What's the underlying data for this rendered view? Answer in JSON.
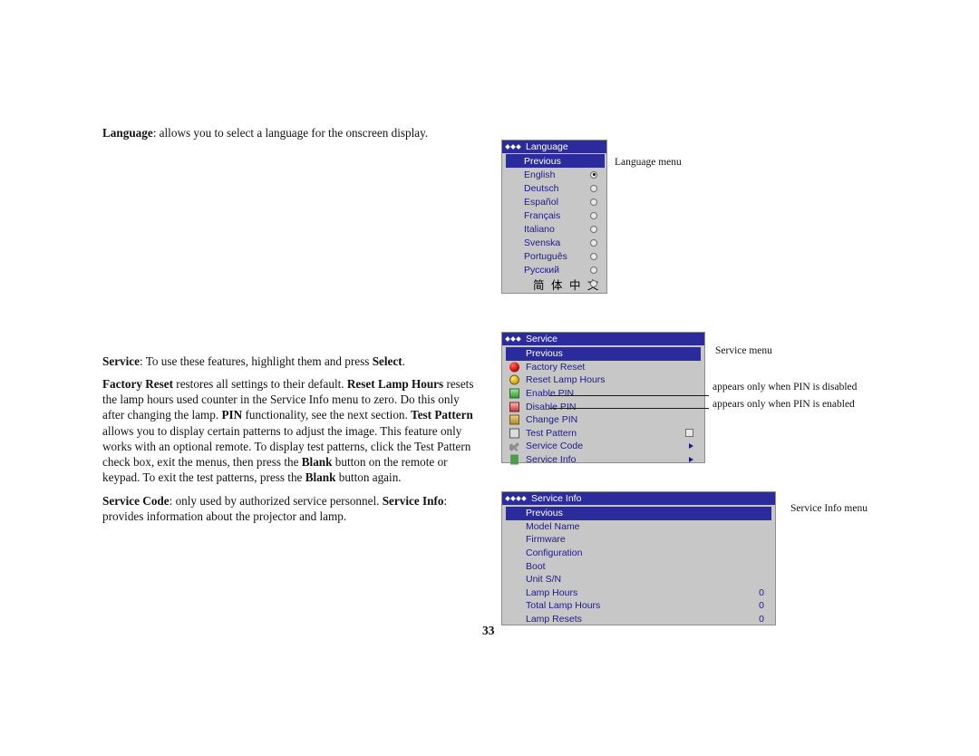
{
  "document": {
    "page_number": "33",
    "paragraphs": {
      "language": {
        "lead": "Language",
        "rest": ": allows you to select a language for the onscreen display."
      },
      "service": {
        "lead": "Service",
        "rest": ": To use these features, highlight them and press ",
        "bold_tail": "Select",
        "period": "."
      },
      "factory": {
        "b1": "Factory Reset",
        "t1": " restores all settings to their default. ",
        "b2": "Reset Lamp Hours",
        "t2": " resets the lamp hours used counter in the Service Info menu to zero. Do this only after changing the lamp. ",
        "b3": "PIN",
        "t3": " functionality, see the next section. ",
        "b4": "Test Pattern",
        "t4": " allows you to display certain patterns to adjust the image. This feature only works with an optional remote. To display test patterns, click the Test Pattern check box, exit the menus, then press the ",
        "b5": "Blank",
        "t5": " button on the remote or keypad. To exit the test patterns, press the ",
        "b6": "Blank",
        "t6": " button again."
      },
      "servicecode": {
        "b1": "Service Code",
        "t1": ": only used by authorized service personnel. ",
        "b2": "Service Info",
        "t2": ": provides information about the projector and lamp."
      }
    },
    "captions": {
      "language_menu": "Language menu",
      "service_menu": "Service menu",
      "pin_disabled": "appears only when PIN is disabled",
      "pin_enabled": "appears only when PIN is enabled",
      "service_info_menu": "Service Info menu"
    }
  },
  "language_menu": {
    "title": "Language",
    "title_dots": 3,
    "previous_label": "Previous",
    "items": [
      {
        "label": "English",
        "selected": true
      },
      {
        "label": "Deutsch",
        "selected": false
      },
      {
        "label": "Español",
        "selected": false
      },
      {
        "label": "Français",
        "selected": false
      },
      {
        "label": "Italiano",
        "selected": false
      },
      {
        "label": "Svenska",
        "selected": false
      },
      {
        "label": "Português",
        "selected": false
      },
      {
        "label": "Русский",
        "selected": false
      }
    ],
    "chinese_label": "简 体 中 文"
  },
  "service_menu": {
    "title": "Service",
    "title_dots": 3,
    "previous_label": "Previous",
    "items": [
      {
        "label": "Factory Reset",
        "icon": "red-dot-icon",
        "control": "none"
      },
      {
        "label": "Reset Lamp Hours",
        "icon": "lamp-icon",
        "control": "none"
      },
      {
        "label": "Enable PIN",
        "icon": "green-pin-icon",
        "control": "none"
      },
      {
        "label": "Disable PIN",
        "icon": "red-pin-icon",
        "control": "none"
      },
      {
        "label": "Change PIN",
        "icon": "key-icon",
        "control": "none"
      },
      {
        "label": "Test Pattern",
        "icon": "pattern-icon",
        "control": "checkbox"
      },
      {
        "label": "Service Code",
        "icon": "wrench-icon",
        "control": "arrow"
      },
      {
        "label": "Service Info",
        "icon": "info-icon",
        "control": "arrow"
      }
    ]
  },
  "service_info_menu": {
    "title": "Service Info",
    "title_dots": 4,
    "previous_label": "Previous",
    "rows": [
      {
        "label": "Model Name",
        "value": ""
      },
      {
        "label": "Firmware",
        "value": ""
      },
      {
        "label": "Configuration",
        "value": ""
      },
      {
        "label": "Boot",
        "value": ""
      },
      {
        "label": "Unit S/N",
        "value": ""
      },
      {
        "label": "Lamp Hours",
        "value": "0"
      },
      {
        "label": "Total Lamp Hours",
        "value": "0"
      },
      {
        "label": "Lamp Resets",
        "value": "0"
      }
    ]
  },
  "colors": {
    "menu_title_bg": "#2b2b9e",
    "menu_bg": "#c7c7c7",
    "menu_text": "#1b1b8c",
    "selected_text": "#ffffff"
  }
}
